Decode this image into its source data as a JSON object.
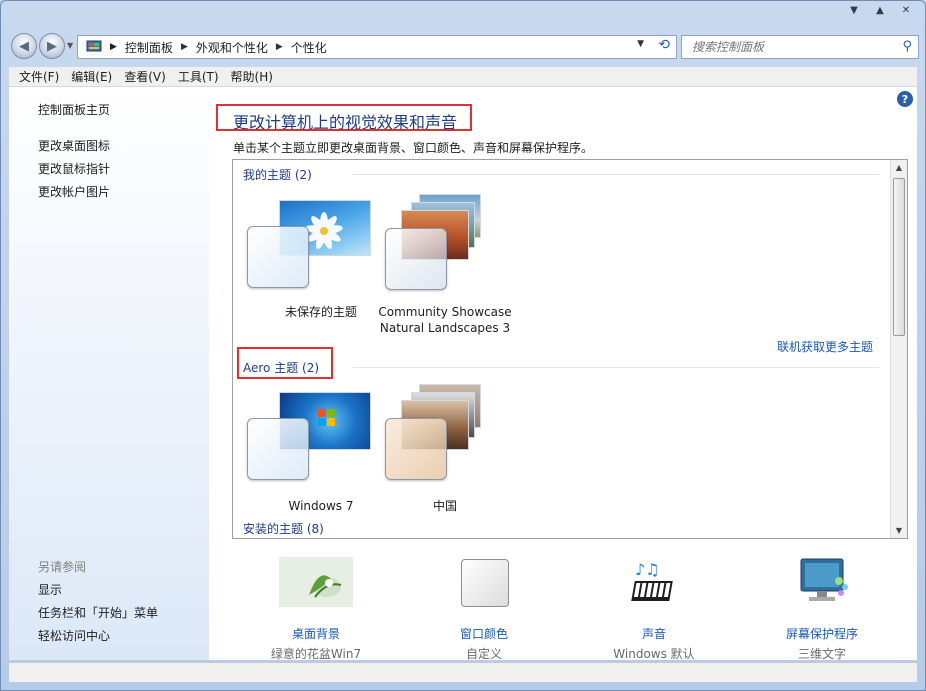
{
  "address": {
    "crumbs": [
      "控制面板",
      "外观和个性化",
      "个性化"
    ],
    "search_placeholder": "搜索控制面板"
  },
  "menu": [
    "文件(F)",
    "编辑(E)",
    "查看(V)",
    "工具(T)",
    "帮助(H)"
  ],
  "sidebar": {
    "home": "控制面板主页",
    "links": [
      "更改桌面图标",
      "更改鼠标指针",
      "更改帐户图片"
    ],
    "see_also_title": "另请参阅",
    "see_also": [
      "显示",
      "任务栏和「开始」菜单",
      "轻松访问中心"
    ]
  },
  "main": {
    "title": "更改计算机上的视觉效果和声音",
    "description": "单击某个主题立即更改桌面背景、窗口颜色、声音和屏幕保护程序。",
    "groups": {
      "my": "我的主题 (2)",
      "aero": "Aero 主题 (2)",
      "installed": "安装的主题 (8)"
    },
    "themes_my": [
      {
        "name": "未保存的主题"
      },
      {
        "name1": "Community Showcase",
        "name2": "Natural Landscapes 3"
      }
    ],
    "themes_aero": [
      {
        "name": "Windows 7"
      },
      {
        "name": "中国"
      }
    ],
    "more_link": "联机获取更多主题"
  },
  "bottom": [
    {
      "label": "桌面背景",
      "sub": "绿意的花盆Win7"
    },
    {
      "label": "窗口颜色",
      "sub": "自定义"
    },
    {
      "label": "声音",
      "sub": "Windows 默认"
    },
    {
      "label": "屏幕保护程序",
      "sub": "三维文字"
    }
  ],
  "colors": {
    "accent": "#1a5ab8",
    "title": "#1e3c8a",
    "highlight": "#e23030"
  }
}
